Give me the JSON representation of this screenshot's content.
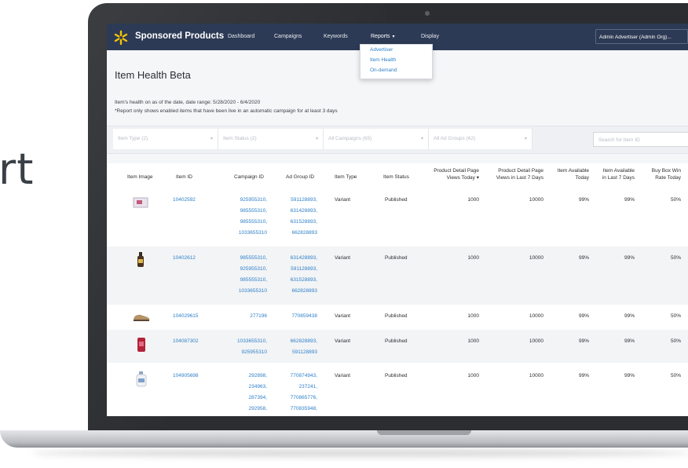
{
  "background_text": "rt",
  "nav": {
    "brand": "Sponsored Products",
    "items": [
      "Dashboard",
      "Campaigns",
      "Keywords",
      "Reports",
      "Display"
    ],
    "reports_caret": "▾",
    "account": "Admin Advertiser (Admin Org)..."
  },
  "reports_menu": [
    "Advertiser",
    "Item Health",
    "On-demand"
  ],
  "page": {
    "title": "Item Health Beta",
    "date_note": "Item's health on as of the date, date range: 5/28/2020 - 6/4/2020",
    "note": "*Report only shows enabled items that have been live in an automatic campaign for at least 3 days"
  },
  "filters": [
    "Item Type (2)",
    "Item Status (2)",
    "All Campaigns (65)",
    "All Ad Groups (62)"
  ],
  "search_placeholder": "Search for Item ID",
  "columns": [
    "Item Image",
    "Item ID",
    "Campaign ID",
    "Ad Group ID",
    "Item Type",
    "Item Status",
    "Product Detail Page\nViews Today ▾",
    "Product Detail Page\nViews in Last 7 Days",
    "Item Available\nToday",
    "Item Available\nin Last 7 Days",
    "Buy Box Win\nRate Today"
  ],
  "rows": [
    {
      "image": "box-product-icon",
      "item_id": "10402592",
      "campaign_ids": "925955310,\n985555310,\n985555310,\n1033655310",
      "ad_group_ids": "591128893,\n631428893,\n631528893,\n662828893",
      "type": "Variant",
      "status": "Published",
      "pdp_today": "1000",
      "pdp_7d": "10000",
      "avail_today": "99%",
      "avail_7d": "99%",
      "buybox": "50%"
    },
    {
      "image": "bottle-product-icon",
      "item_id": "10402612",
      "campaign_ids": "985555310,\n925955310,\n985555310,\n1033655310",
      "ad_group_ids": "631428893,\n591128893,\n631528893,\n662828893",
      "type": "Variant",
      "status": "Published",
      "pdp_today": "1000",
      "pdp_7d": "10000",
      "avail_today": "99%",
      "avail_7d": "99%",
      "buybox": "50%"
    },
    {
      "image": "shoe-product-icon",
      "item_id": "104029615",
      "campaign_ids": "277196",
      "ad_group_ids": "770859438",
      "type": "Variant",
      "status": "Published",
      "pdp_today": "1000",
      "pdp_7d": "10000",
      "avail_today": "99%",
      "avail_7d": "99%",
      "buybox": "50%"
    },
    {
      "image": "can-product-icon",
      "item_id": "104087302",
      "campaign_ids": "1033655310,\n925955310",
      "ad_group_ids": "662828893,\n591128893",
      "type": "Variant",
      "status": "Published",
      "pdp_today": "1000",
      "pdp_7d": "10000",
      "avail_today": "99%",
      "avail_7d": "99%",
      "buybox": "50%"
    },
    {
      "image": "jug-product-icon",
      "item_id": "104905698",
      "campaign_ids": "292898,\n234963,\n287394,\n292958,",
      "ad_group_ids": "770874943,\n237241,\n770865776,\n770835948,",
      "type": "Variant",
      "status": "Published",
      "pdp_today": "1000",
      "pdp_7d": "10000",
      "avail_today": "99%",
      "avail_7d": "99%",
      "buybox": "50%"
    }
  ],
  "colors": {
    "nav_bg": "#2d3a55",
    "link": "#2f80c8",
    "logo": "#f5c400"
  }
}
